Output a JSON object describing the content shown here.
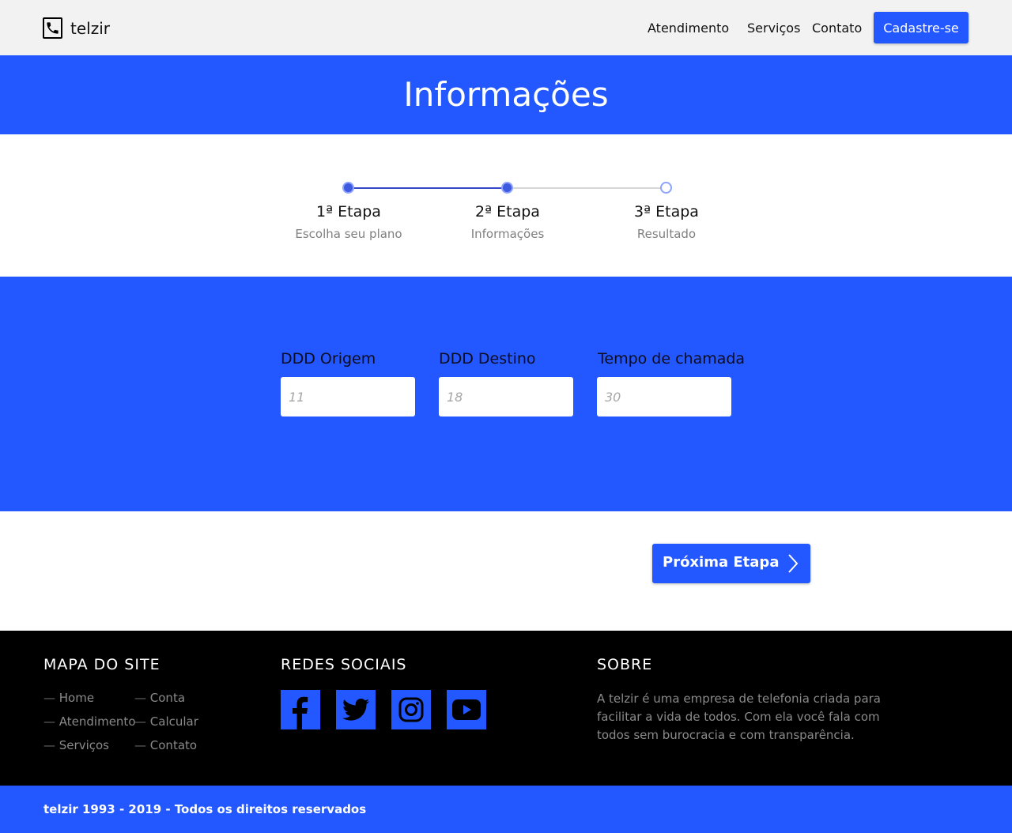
{
  "header": {
    "brand": "telzir",
    "nav": [
      "Atendimento",
      "Serviços",
      "Contato"
    ],
    "signup_label": "Cadastre-se"
  },
  "hero": {
    "title": "Informações"
  },
  "steps": [
    {
      "title": "1ª Etapa",
      "subtitle": "Escolha seu plano",
      "state": "done"
    },
    {
      "title": "2ª Etapa",
      "subtitle": "Informações",
      "state": "current"
    },
    {
      "title": "3ª Etapa",
      "subtitle": "Resultado",
      "state": "pending"
    }
  ],
  "form": {
    "fields": [
      {
        "label": "DDD Origem",
        "placeholder": "11",
        "value": ""
      },
      {
        "label": "DDD Destino",
        "placeholder": "18",
        "value": ""
      },
      {
        "label": "Tempo de chamada",
        "placeholder": "30",
        "value": ""
      }
    ],
    "next_label": "Próxima Etapa"
  },
  "footer": {
    "sitemap_heading": "MAPA DO SITE",
    "sitemap_links": [
      "Home",
      "Atendimento",
      "Serviços",
      "Conta",
      "Calcular",
      "Contato"
    ],
    "social_heading": "REDES SOCIAIS",
    "social_icons": [
      "facebook-icon",
      "twitter-icon",
      "instagram-icon",
      "youtube-icon"
    ],
    "about_heading": "SOBRE",
    "about_text": "A telzir é uma empresa de telefonia criada para facilitar a vida de todos. Com ela você fala com todos sem burocracia e com transparência.",
    "copyright": "telzir 1993 - 2019 - Todos os direitos reservados"
  },
  "colors": {
    "accent": "#2357ff",
    "header_bg": "#f2f2f2",
    "footer_bg": "#000000",
    "muted_text": "#8a8a8a"
  }
}
